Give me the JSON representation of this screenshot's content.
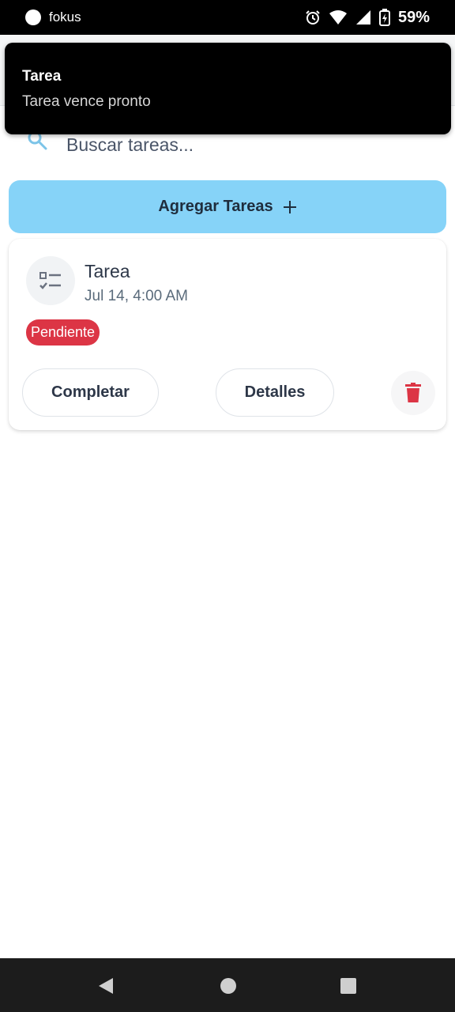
{
  "status_bar": {
    "app_name": "fokus",
    "battery": "59%",
    "icons": [
      "alarm-icon",
      "wifi-icon",
      "cell-signal-icon",
      "battery-charging-icon"
    ]
  },
  "notification": {
    "title": "Tarea",
    "text": "Tarea vence pronto"
  },
  "search": {
    "placeholder": "Buscar tareas..."
  },
  "add_button": {
    "label": "Agregar Tareas",
    "icon": "plus-icon"
  },
  "task": {
    "title": "Tarea",
    "date": "Jul 14, 4:00 AM",
    "status": "Pendiente",
    "complete_label": "Completar",
    "details_label": "Detalles",
    "icon": "checklist-icon",
    "delete_icon": "trash-icon"
  },
  "colors": {
    "accent": "#86d3f8",
    "danger": "#dc3545",
    "search_icon": "#7cc4e8"
  }
}
